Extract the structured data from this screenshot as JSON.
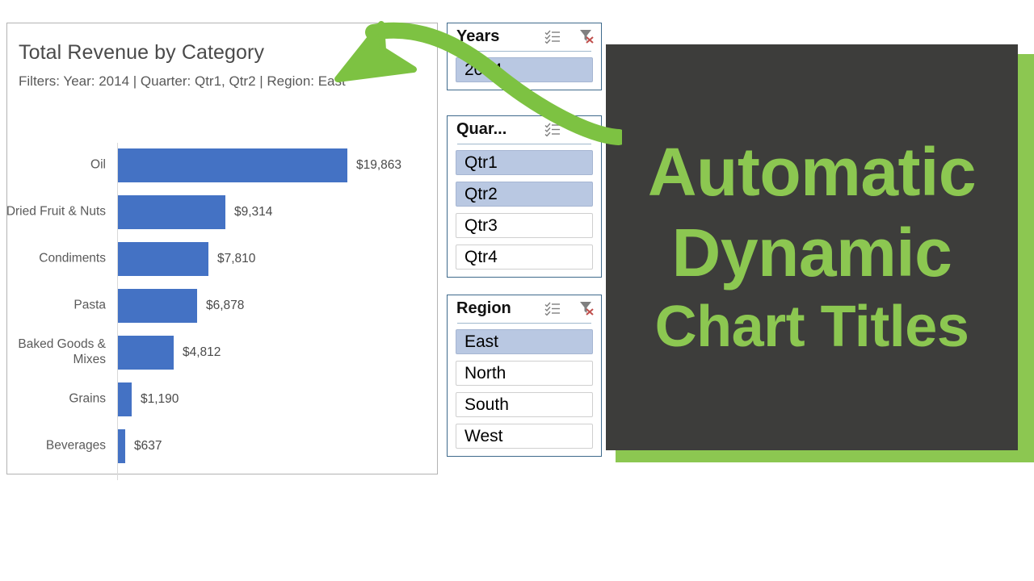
{
  "chart": {
    "title": "Total Revenue by Category",
    "subtitle": "Filters: Year: 2014 | Quarter: Qtr1, Qtr2 | Region: East"
  },
  "chart_data": {
    "type": "bar",
    "orientation": "horizontal",
    "title": "Total Revenue by Category",
    "subtitle": "Filters: Year: 2014 | Quarter: Qtr1, Qtr2 | Region: East",
    "xlabel": "",
    "ylabel": "",
    "grid": false,
    "legend": false,
    "bar_color": "#4472C4",
    "categories": [
      "Oil",
      "Dried Fruit & Nuts",
      "Condiments",
      "Pasta",
      "Baked Goods & Mixes",
      "Grains",
      "Beverages"
    ],
    "values": [
      19863,
      9314,
      7810,
      6878,
      4812,
      1190,
      637
    ],
    "value_labels": [
      "$19,863",
      "$9,314",
      "$7,810",
      "$6,878",
      "$4,812",
      "$1,190",
      "$637"
    ],
    "xlim": [
      0,
      20000
    ]
  },
  "slicers": [
    {
      "name": "Years",
      "multiselect_icon": "multi-select-icon",
      "clear_icon": "clear-filter-icon",
      "items": [
        {
          "label": "2014",
          "selected": true
        }
      ]
    },
    {
      "name": "Quar...",
      "multiselect_icon": "multi-select-icon",
      "clear_icon": "clear-filter-icon",
      "items": [
        {
          "label": "Qtr1",
          "selected": true
        },
        {
          "label": "Qtr2",
          "selected": true
        },
        {
          "label": "Qtr3",
          "selected": false
        },
        {
          "label": "Qtr4",
          "selected": false
        }
      ]
    },
    {
      "name": "Region",
      "multiselect_icon": "multi-select-icon",
      "clear_icon": "clear-filter-icon",
      "items": [
        {
          "label": "East",
          "selected": true
        },
        {
          "label": "North",
          "selected": false
        },
        {
          "label": "South",
          "selected": false
        },
        {
          "label": "West",
          "selected": false
        }
      ]
    }
  ],
  "promo": {
    "line1": "Automatic",
    "line2": "Dynamic",
    "line3": "Chart Titles",
    "text_color": "#8CC751",
    "background_color": "#3D3D3B",
    "accent_color": "#8CC751"
  },
  "arrow": {
    "color": "#7DC242",
    "name": "curved-arrow-pointing-to-chart-title"
  }
}
